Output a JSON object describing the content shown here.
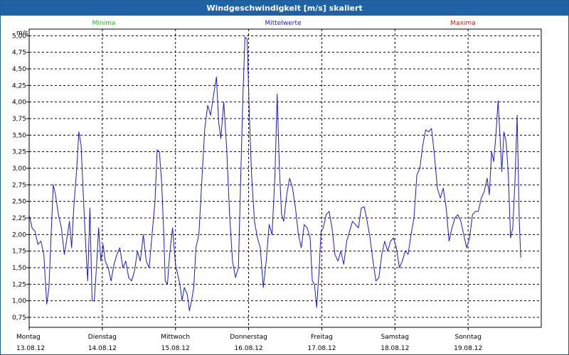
{
  "window": {
    "title": "Windgeschwindigkeit [m/s] skaliert"
  },
  "chart_data": {
    "type": "line",
    "unit": "m/s",
    "legend": [
      {
        "label": "Minima",
        "color": "#33aa33"
      },
      {
        "label": "Mittelwerte",
        "color": "#1a1acc"
      },
      {
        "label": "Maxima",
        "color": "#cc2222"
      }
    ],
    "ylim": [
      0.6,
      5.1
    ],
    "yticks": [
      "0,75",
      "1,00",
      "1,25",
      "1,50",
      "1,75",
      "2,00",
      "2,25",
      "2,50",
      "2,75",
      "3,00",
      "3,25",
      "3,50",
      "3,75",
      "4,00",
      "4,25",
      "4,50",
      "4,75",
      "5,00"
    ],
    "xlim": [
      0,
      7
    ],
    "xticks": [
      {
        "day": "Montag",
        "date": "13.08.12"
      },
      {
        "day": "Dienstag",
        "date": "14.08.12"
      },
      {
        "day": "Mittwoch",
        "date": "15.08.12"
      },
      {
        "day": "Donnerstag",
        "date": "16.08.12"
      },
      {
        "day": "Freitag",
        "date": "17.08.12"
      },
      {
        "day": "Samstag",
        "date": "18.08.12"
      },
      {
        "day": "Sonntag",
        "date": "19.08.12"
      }
    ],
    "grid": true,
    "series": [
      {
        "color": "#1a1acc",
        "points": [
          [
            0.0,
            2.3
          ],
          [
            0.04,
            2.1
          ],
          [
            0.08,
            2.05
          ],
          [
            0.12,
            1.85
          ],
          [
            0.16,
            1.9
          ],
          [
            0.2,
            1.7
          ],
          [
            0.24,
            0.95
          ],
          [
            0.27,
            1.2
          ],
          [
            0.3,
            2.0
          ],
          [
            0.33,
            2.75
          ],
          [
            0.36,
            2.6
          ],
          [
            0.4,
            2.3
          ],
          [
            0.44,
            2.1
          ],
          [
            0.48,
            1.7
          ],
          [
            0.51,
            1.9
          ],
          [
            0.55,
            2.2
          ],
          [
            0.58,
            1.8
          ],
          [
            0.61,
            2.4
          ],
          [
            0.65,
            3.0
          ],
          [
            0.68,
            3.55
          ],
          [
            0.71,
            3.35
          ],
          [
            0.74,
            2.6
          ],
          [
            0.77,
            1.9
          ],
          [
            0.8,
            1.3
          ],
          [
            0.83,
            2.4
          ],
          [
            0.86,
            1.0
          ],
          [
            0.89,
            1.0
          ],
          [
            0.92,
            1.5
          ],
          [
            0.95,
            2.1
          ],
          [
            0.98,
            1.6
          ],
          [
            1.01,
            1.85
          ],
          [
            1.04,
            1.6
          ],
          [
            1.08,
            1.5
          ],
          [
            1.12,
            1.3
          ],
          [
            1.16,
            1.55
          ],
          [
            1.2,
            1.7
          ],
          [
            1.24,
            1.8
          ],
          [
            1.28,
            1.5
          ],
          [
            1.32,
            1.6
          ],
          [
            1.36,
            1.35
          ],
          [
            1.4,
            1.3
          ],
          [
            1.44,
            1.45
          ],
          [
            1.48,
            1.75
          ],
          [
            1.52,
            1.6
          ],
          [
            1.56,
            2.0
          ],
          [
            1.6,
            1.6
          ],
          [
            1.64,
            1.5
          ],
          [
            1.68,
            2.0
          ],
          [
            1.72,
            2.5
          ],
          [
            1.75,
            3.28
          ],
          [
            1.78,
            3.25
          ],
          [
            1.81,
            2.8
          ],
          [
            1.84,
            2.0
          ],
          [
            1.86,
            1.3
          ],
          [
            1.89,
            1.25
          ],
          [
            1.92,
            1.7
          ],
          [
            1.96,
            2.1
          ],
          [
            2.0,
            1.55
          ],
          [
            2.03,
            1.4
          ],
          [
            2.06,
            1.25
          ],
          [
            2.09,
            1.0
          ],
          [
            2.12,
            1.2
          ],
          [
            2.16,
            1.1
          ],
          [
            2.19,
            0.85
          ],
          [
            2.22,
            1.0
          ],
          [
            2.25,
            1.2
          ],
          [
            2.28,
            1.8
          ],
          [
            2.32,
            2.0
          ],
          [
            2.36,
            2.8
          ],
          [
            2.4,
            3.6
          ],
          [
            2.44,
            3.95
          ],
          [
            2.48,
            3.8
          ],
          [
            2.52,
            4.1
          ],
          [
            2.56,
            4.38
          ],
          [
            2.59,
            3.7
          ],
          [
            2.62,
            3.45
          ],
          [
            2.66,
            4.0
          ],
          [
            2.7,
            3.3
          ],
          [
            2.74,
            2.3
          ],
          [
            2.78,
            1.6
          ],
          [
            2.82,
            1.35
          ],
          [
            2.86,
            1.5
          ],
          [
            2.89,
            2.8
          ],
          [
            2.92,
            4.0
          ],
          [
            2.95,
            4.98
          ],
          [
            2.98,
            4.95
          ],
          [
            3.01,
            3.8
          ],
          [
            3.04,
            2.9
          ],
          [
            3.08,
            2.2
          ],
          [
            3.12,
            1.95
          ],
          [
            3.16,
            1.8
          ],
          [
            3.2,
            1.2
          ],
          [
            3.24,
            1.6
          ],
          [
            3.28,
            2.15
          ],
          [
            3.32,
            2.0
          ],
          [
            3.36,
            2.9
          ],
          [
            3.39,
            4.12
          ],
          [
            3.42,
            3.0
          ],
          [
            3.45,
            2.3
          ],
          [
            3.48,
            2.2
          ],
          [
            3.52,
            2.6
          ],
          [
            3.56,
            2.85
          ],
          [
            3.6,
            2.7
          ],
          [
            3.64,
            2.4
          ],
          [
            3.68,
            2.0
          ],
          [
            3.72,
            1.8
          ],
          [
            3.76,
            2.15
          ],
          [
            3.8,
            2.1
          ],
          [
            3.84,
            1.95
          ],
          [
            3.87,
            1.3
          ],
          [
            3.9,
            1.25
          ],
          [
            3.93,
            0.9
          ],
          [
            3.96,
            1.4
          ],
          [
            3.99,
            2.05
          ],
          [
            4.02,
            2.1
          ],
          [
            4.06,
            2.3
          ],
          [
            4.1,
            2.35
          ],
          [
            4.14,
            2.1
          ],
          [
            4.18,
            1.7
          ],
          [
            4.22,
            1.6
          ],
          [
            4.26,
            1.75
          ],
          [
            4.3,
            1.55
          ],
          [
            4.34,
            1.9
          ],
          [
            4.38,
            2.05
          ],
          [
            4.42,
            2.2
          ],
          [
            4.46,
            2.15
          ],
          [
            4.5,
            2.1
          ],
          [
            4.54,
            2.4
          ],
          [
            4.58,
            2.42
          ],
          [
            4.62,
            2.2
          ],
          [
            4.66,
            1.95
          ],
          [
            4.7,
            1.6
          ],
          [
            4.74,
            1.3
          ],
          [
            4.78,
            1.35
          ],
          [
            4.82,
            1.7
          ],
          [
            4.86,
            1.9
          ],
          [
            4.9,
            1.75
          ],
          [
            4.94,
            1.9
          ],
          [
            4.98,
            1.95
          ],
          [
            5.02,
            1.8
          ],
          [
            5.06,
            1.5
          ],
          [
            5.1,
            1.6
          ],
          [
            5.14,
            1.75
          ],
          [
            5.18,
            1.7
          ],
          [
            5.22,
            2.0
          ],
          [
            5.26,
            2.25
          ],
          [
            5.3,
            2.9
          ],
          [
            5.34,
            3.0
          ],
          [
            5.38,
            3.35
          ],
          [
            5.42,
            3.58
          ],
          [
            5.46,
            3.55
          ],
          [
            5.5,
            3.6
          ],
          [
            5.54,
            3.2
          ],
          [
            5.58,
            2.7
          ],
          [
            5.62,
            2.55
          ],
          [
            5.66,
            2.7
          ],
          [
            5.7,
            2.4
          ],
          [
            5.74,
            1.9
          ],
          [
            5.78,
            2.1
          ],
          [
            5.82,
            2.25
          ],
          [
            5.86,
            2.3
          ],
          [
            5.9,
            2.2
          ],
          [
            5.94,
            2.0
          ],
          [
            5.98,
            1.8
          ],
          [
            6.02,
            1.95
          ],
          [
            6.06,
            2.3
          ],
          [
            6.1,
            2.35
          ],
          [
            6.14,
            2.35
          ],
          [
            6.18,
            2.55
          ],
          [
            6.22,
            2.65
          ],
          [
            6.26,
            2.85
          ],
          [
            6.29,
            2.6
          ],
          [
            6.32,
            3.25
          ],
          [
            6.35,
            3.1
          ],
          [
            6.38,
            3.5
          ],
          [
            6.41,
            4.02
          ],
          [
            6.44,
            3.4
          ],
          [
            6.46,
            2.95
          ],
          [
            6.49,
            3.55
          ],
          [
            6.52,
            3.4
          ],
          [
            6.55,
            2.9
          ],
          [
            6.58,
            1.95
          ],
          [
            6.61,
            2.1
          ],
          [
            6.64,
            2.8
          ],
          [
            6.67,
            3.8
          ],
          [
            6.7,
            2.2
          ],
          [
            6.72,
            1.65
          ]
        ]
      }
    ]
  }
}
